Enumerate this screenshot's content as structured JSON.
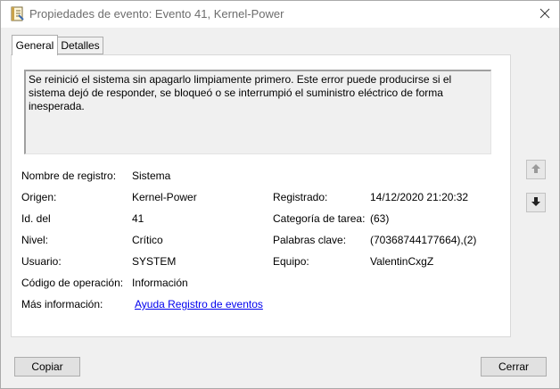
{
  "window": {
    "title": "Propiedades de evento: Evento 41, Kernel-Power"
  },
  "tabs": [
    {
      "label": "General",
      "active": true
    },
    {
      "label": "Detalles",
      "active": false
    }
  ],
  "description": "Se reinició el sistema sin apagarlo limpiamente primero. Este error puede producirse si el sistema dejó de responder, se bloqueó o se interrumpió el suministro eléctrico de forma inesperada.",
  "fields": {
    "log_name": {
      "label": "Nombre de registro:",
      "value": "Sistema"
    },
    "source": {
      "label": "Origen:",
      "value": "Kernel-Power"
    },
    "logged": {
      "label": "Registrado:",
      "value": "14/12/2020 21:20:32"
    },
    "event_id": {
      "label": "Id. del",
      "value": "41"
    },
    "task_category": {
      "label": "Categoría de tarea:",
      "value": "(63)"
    },
    "level": {
      "label": "Nivel:",
      "value": "Crítico"
    },
    "keywords": {
      "label": "Palabras clave:",
      "value": "(70368744177664),(2)"
    },
    "user": {
      "label": "Usuario:",
      "value": "SYSTEM"
    },
    "computer": {
      "label": "Equipo:",
      "value": "ValentinCxgZ"
    },
    "opcode": {
      "label": "Código de operación:",
      "value": "Información"
    },
    "more_info": {
      "label": "Más información:",
      "link": "Ayuda Registro de eventos"
    }
  },
  "buttons": {
    "copy": "Copiar",
    "close": "Cerrar"
  },
  "icons": {
    "window": "event-properties-icon",
    "close": "close-icon",
    "up": "arrow-up-icon",
    "down": "arrow-down-icon"
  },
  "colors": {
    "link": "#0000ee",
    "panel": "#ffffff",
    "background": "#f0f0f0"
  }
}
